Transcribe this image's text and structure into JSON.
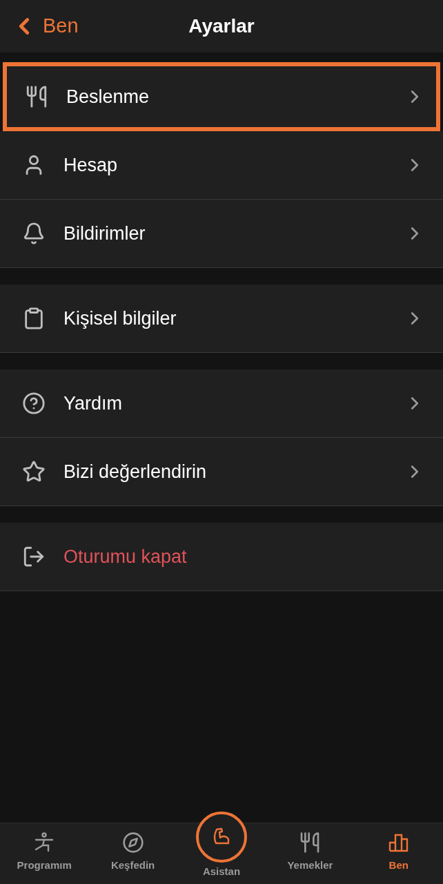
{
  "header": {
    "back_label": "Ben",
    "title": "Ayarlar"
  },
  "groups": [
    {
      "items": [
        {
          "label": "Beslenme",
          "kind": "normal",
          "highlighted": true
        },
        {
          "label": "Hesap",
          "kind": "normal",
          "highlighted": false
        },
        {
          "label": "Bildirimler",
          "kind": "normal",
          "highlighted": false
        }
      ]
    },
    {
      "items": [
        {
          "label": "Kişisel bilgiler",
          "kind": "normal",
          "highlighted": false
        }
      ]
    },
    {
      "items": [
        {
          "label": "Yardım",
          "kind": "normal",
          "highlighted": false
        },
        {
          "label": "Bizi değerlendirin",
          "kind": "normal",
          "highlighted": false
        }
      ]
    },
    {
      "items": [
        {
          "label": "Oturumu kapat",
          "kind": "danger",
          "highlighted": false
        }
      ]
    }
  ],
  "tab_bar": [
    {
      "label": "Programım",
      "kind": "tab",
      "selected": false
    },
    {
      "label": "Keşfedin",
      "kind": "tab",
      "selected": false
    },
    {
      "label": "Asistan",
      "kind": "center",
      "selected": false
    },
    {
      "label": "Yemekler",
      "kind": "tab",
      "selected": false
    },
    {
      "label": "Ben",
      "kind": "tab",
      "selected": true
    }
  ]
}
